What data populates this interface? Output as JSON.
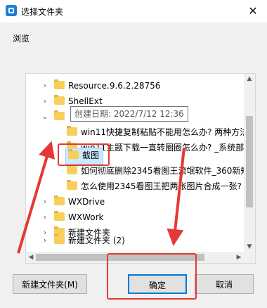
{
  "window": {
    "title": "选择文件夹",
    "close_glyph": "✕"
  },
  "description": "浏览",
  "tree": {
    "items": [
      {
        "label": "Resource.9.6.2.28756",
        "chevron": "›",
        "expanded": false
      },
      {
        "label": "ShellExt",
        "chevron": "›",
        "expanded": false
      },
      {
        "label": "",
        "chevron": "⌄",
        "expanded": true
      },
      {
        "label": "win11快捷复制粘贴不能用怎么办? 两种方法",
        "chevron": "",
        "expanded": false
      },
      {
        "label": "win11主题下载一直转圈圈怎么办? _系统部落",
        "chevron": "",
        "expanded": false
      },
      {
        "label": "截图",
        "chevron": "",
        "selected": true
      },
      {
        "label": "如何彻底删除2345看图王流氓软件_360新知",
        "chevron": "",
        "expanded": false
      },
      {
        "label": "怎么使用2345看图王把两张图片合成一张?",
        "chevron": "",
        "expanded": false
      },
      {
        "label": "WXDrive",
        "chevron": "›",
        "expanded": false
      },
      {
        "label": "WXWork",
        "chevron": "›",
        "expanded": false
      },
      {
        "label": "新建文件夹",
        "chevron": "›",
        "expanded": false
      },
      {
        "label": "新建文件夹 (2)",
        "chevron": "›",
        "expanded": false
      }
    ]
  },
  "tooltip": "创建日期: 2022/7/12 12:36",
  "buttons": {
    "new_folder": "新建文件夹(M)",
    "ok": "确定",
    "cancel": "取消"
  },
  "colors": {
    "annotation": "#e53935",
    "selection": "#cce8ff",
    "folder": "#f8cf5b",
    "accent": "#0078d7"
  }
}
